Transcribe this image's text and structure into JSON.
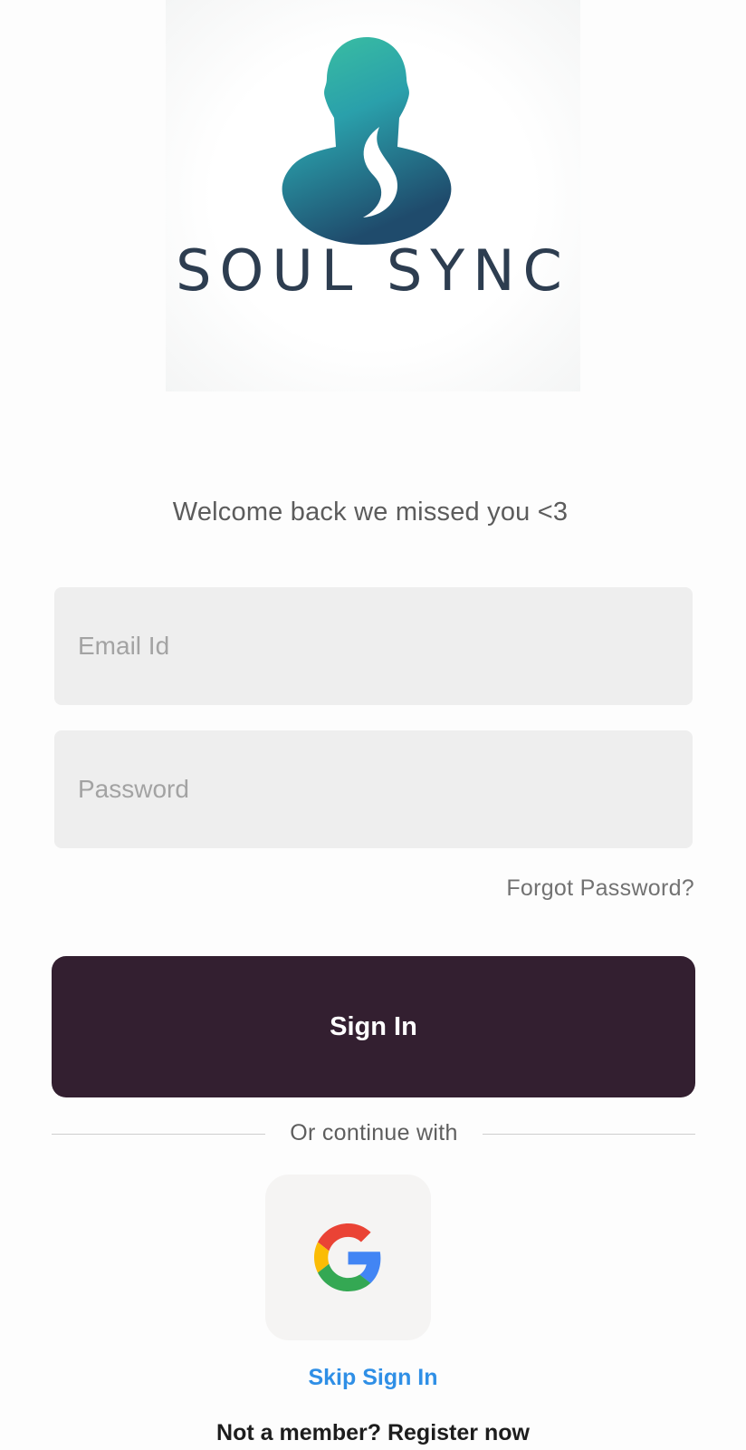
{
  "logo": {
    "text": "SOUL SYNC",
    "icon": "person-silhouette-logo-icon",
    "colors": [
      "#3cc3a0",
      "#2aa4ab",
      "#1f4b6c"
    ]
  },
  "welcome_text": "Welcome back we missed you <3",
  "email": {
    "placeholder": "Email Id",
    "value": ""
  },
  "password": {
    "placeholder": "Password",
    "value": ""
  },
  "forgot_password_label": "Forgot Password?",
  "sign_in_label": "Sign In",
  "divider_text": "Or continue with",
  "google_button": {
    "icon": "google-icon"
  },
  "skip_label": "Skip Sign In",
  "register": {
    "prompt": "Not a member? ",
    "link_label": "Register now"
  },
  "colors": {
    "primary_button": "#331f30",
    "link_blue": "#2f8fe6",
    "field_background": "#eeeeee"
  }
}
